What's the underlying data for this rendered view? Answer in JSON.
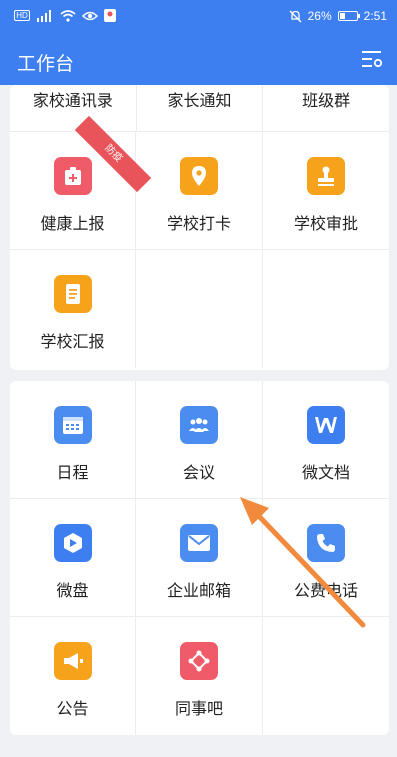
{
  "status_bar": {
    "left_icons": [
      "sim-icon",
      "signal-icon",
      "wifi-icon",
      "eye-icon",
      "map-pin-icon"
    ],
    "sim_label": "HD",
    "mute_icon": "bell-off-icon",
    "battery_percent": "26%",
    "time": "2:51"
  },
  "header": {
    "title": "工作台"
  },
  "card1": {
    "top_row": [
      "家校通讯录",
      "家长通知",
      "班级群"
    ],
    "tiles": [
      {
        "label": "健康上报",
        "icon": "medical-kit-icon",
        "color": "#ef5b68",
        "ribbon": "防疫"
      },
      {
        "label": "学校打卡",
        "icon": "location-pin-icon",
        "color": "#f7a21b"
      },
      {
        "label": "学校审批",
        "icon": "stamp-icon",
        "color": "#f7a21b"
      },
      {
        "label": "学校汇报",
        "icon": "report-doc-icon",
        "color": "#f7a21b"
      }
    ]
  },
  "card2": {
    "tiles": [
      {
        "label": "日程",
        "icon": "calendar-icon",
        "color": "#4a8cf0"
      },
      {
        "label": "会议",
        "icon": "meeting-people-icon",
        "color": "#4a8cf0"
      },
      {
        "label": "微文档",
        "icon": "word-doc-icon",
        "color": "#3d7ff0"
      },
      {
        "label": "微盘",
        "icon": "cloud-disk-icon",
        "color": "#3d7ff0"
      },
      {
        "label": "企业邮箱",
        "icon": "mail-icon",
        "color": "#4a8cf0"
      },
      {
        "label": "公费电话",
        "icon": "phone-icon",
        "color": "#4a8cf0"
      },
      {
        "label": "公告",
        "icon": "megaphone-icon",
        "color": "#f7a21b"
      },
      {
        "label": "同事吧",
        "icon": "colleague-network-icon",
        "color": "#ef5b68"
      }
    ]
  },
  "annotation": {
    "color": "#f28a3e"
  }
}
